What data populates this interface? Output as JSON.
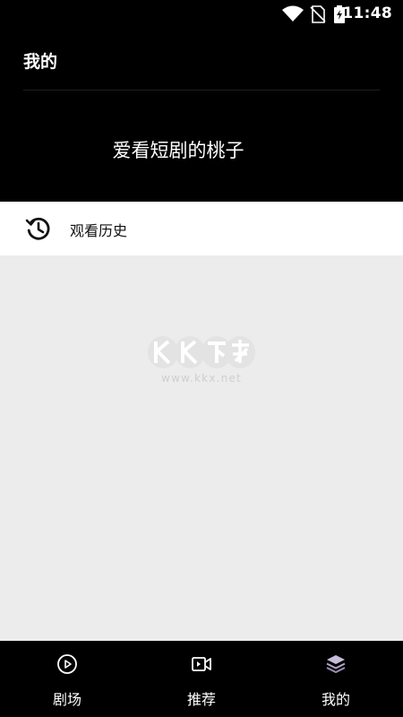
{
  "status_bar": {
    "time": "11:48"
  },
  "header": {
    "title": "我的",
    "username": "爱看短剧的桃子"
  },
  "history": {
    "label": "观看历史"
  },
  "bottom_nav": {
    "items": [
      {
        "label": "剧场",
        "icon": "play-circle-icon"
      },
      {
        "label": "推荐",
        "icon": "video-camera-icon"
      },
      {
        "label": "我的",
        "icon": "layers-icon",
        "active": true
      }
    ]
  },
  "colors": {
    "header_bg": "#000000",
    "content_bg": "#ececec",
    "active_icon": "#b3a6c9",
    "text_light": "#ffffff"
  }
}
